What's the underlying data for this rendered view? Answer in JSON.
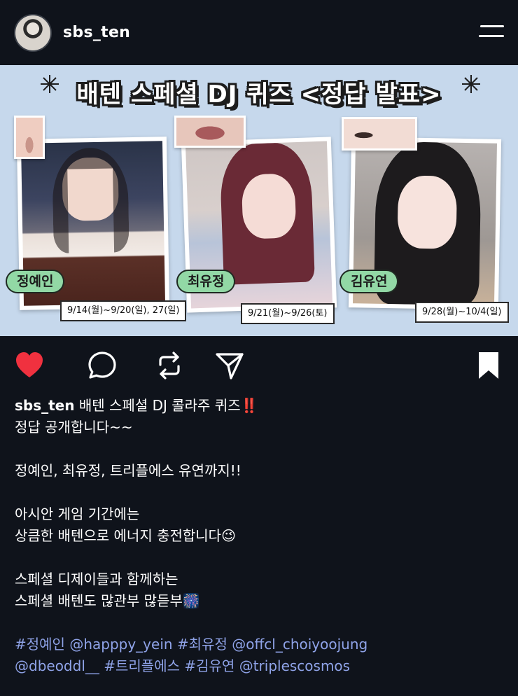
{
  "header": {
    "username": "sbs_ten"
  },
  "post_image": {
    "title": "배텐 스페셜 DJ 퀴즈 <정답 발표>",
    "cards": [
      {
        "name": "정예인",
        "dates": "9/14(월)~9/20(일), 27(일)"
      },
      {
        "name": "최유정",
        "dates": "9/21(월)~9/26(토)"
      },
      {
        "name": "김유연",
        "dates": "9/28(월)~10/4(일)"
      }
    ]
  },
  "caption": {
    "username": "sbs_ten",
    "line1": "배텐 스페셜 DJ 콜라주 퀴즈",
    "line1_emoji": "‼️",
    "line2": "정답 공개합니다~~",
    "line3": "정예인, 최유정, 트리플에스 유연까지!!",
    "line4": "아시안 게임 기간에는",
    "line5": "상큼한 배텐으로 에너지 충전합니다",
    "line5_emoji": "😉",
    "line6": "스페셜 디제이들과 함께하는",
    "line7": "스페셜 배텐도 많관부 많듣부",
    "line7_emoji": "🎆",
    "tags_row1": [
      "#정예인",
      "@happpy_yein",
      "#최유정",
      "@offcl_choiyoojung"
    ],
    "tags_row2": [
      "@dbeoddl__",
      "#트리플에스",
      "#김유연",
      "@triplescosmos"
    ]
  },
  "icons": {
    "heart": "heart-filled-icon",
    "comment": "comment-icon",
    "repost": "repost-icon",
    "share": "send-icon",
    "bookmark": "bookmark-icon",
    "menu": "menu-icon"
  },
  "colors": {
    "background": "#0f131b",
    "heart": "#f0313f",
    "tag_link": "#8fa3e8",
    "image_bg": "#c6d8ec",
    "name_tag": "#92d8a5"
  }
}
